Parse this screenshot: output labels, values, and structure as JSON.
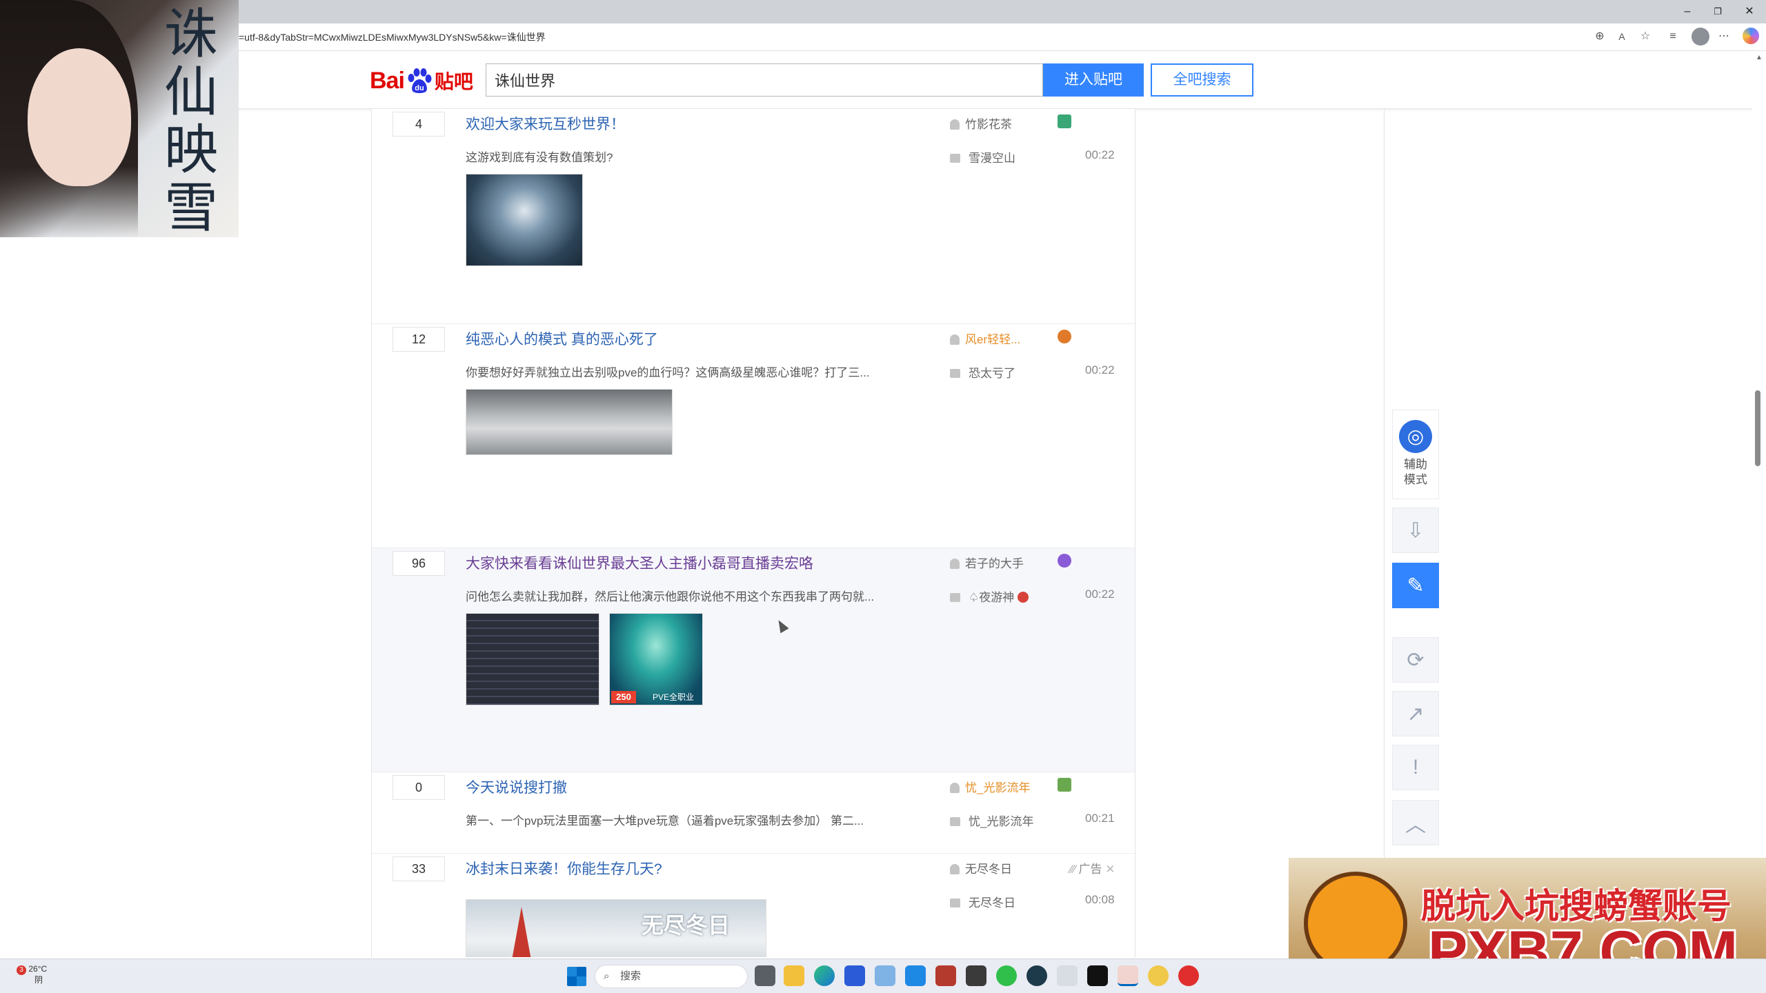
{
  "browser": {
    "url": "=utf-8&dyTabStr=MCwxMiwzLDEsMiwxMyw3LDYsNSw5&kw=诛仙世界",
    "window_controls": {
      "minimize": "–",
      "restore": "❐",
      "close": "✕"
    }
  },
  "header": {
    "logo_bai": "Bai",
    "logo_tieba": "贴吧",
    "search_value": "诛仙世界",
    "enter_button": "进入贴吧",
    "all_search_button": "全吧搜索"
  },
  "threads": [
    {
      "replies": "4",
      "title": "欢迎大家来玩互秒世界！",
      "abstract": "这游戏到底有没有数值策划?",
      "author": "竹影花茶",
      "last_reply_user": "雪漫空山",
      "time": "00:22",
      "badge_color": "#3aa776"
    },
    {
      "replies": "12",
      "title": "纯恶心人的模式 真的恶心死了",
      "abstract": "你要想好好弄就独立出去别吸pve的血行吗？这俩高级星魄恶心谁呢？打了三...",
      "author": "风er轻轻...",
      "last_reply_user": "恐太亏了",
      "time": "00:22",
      "badge_color": "#e07a2a"
    },
    {
      "replies": "96",
      "title": "大家快来看看诛仙世界最大圣人主播小磊哥直播卖宏咯",
      "abstract": "问他怎么卖就让我加群，然后让他演示他跟你说他不用这个东西我串了两句就...",
      "author": "若子的大手",
      "last_reply_user": "♤夜游神",
      "time": "00:22",
      "badge_color": "#8a5bd6",
      "thumb_label": "250",
      "thumb_caption": "PVE全职业"
    },
    {
      "replies": "0",
      "title": "今天说说搜打撤",
      "abstract": "第一、一个pvp玩法里面塞一大堆pve玩意（逼着pve玩家强制去参加） 第二...",
      "author": "忧_光影流年",
      "last_reply_user": "忧_光影流年",
      "time": "00:21",
      "badge_color": "#6aa84f"
    },
    {
      "replies": "33",
      "title": "冰封末日来袭！你能生存几天?",
      "author": "无尽冬日",
      "last_reply_user": "无尽冬日",
      "time": "00:08",
      "ad_label": "广告",
      "thumb_text": "无尽冬日"
    }
  ],
  "sidebar": {
    "assist_label_1": "辅助",
    "assist_label_2": "模式"
  },
  "ads": {
    "topleft_text": "诛仙映雪",
    "bottomright_line1": "脱坑入坑搜螃蟹账号",
    "bottomright_line2": "PXB7.COM"
  },
  "taskbar": {
    "weather_temp": "26°C",
    "weather_desc": "阴",
    "weather_alert": "3",
    "search_placeholder": "搜索"
  }
}
